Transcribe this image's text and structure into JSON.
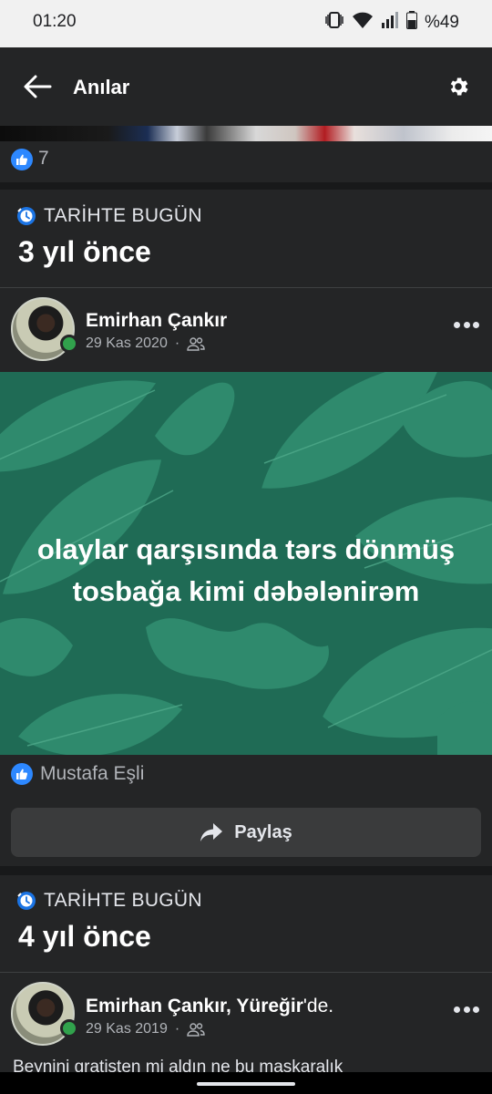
{
  "status_bar": {
    "time": "01:20",
    "battery": "%49"
  },
  "app_bar": {
    "title": "Anılar"
  },
  "previous_post": {
    "like_count": "7"
  },
  "memory_1": {
    "section_label": "TARİHTE BUGÜN",
    "years_ago": "3 yıl önce",
    "author": "Emirhan Çankır",
    "date": "29 Kas 2020",
    "dot": "·",
    "post_text_line1": "olaylar qarşısında tərs dönmüş",
    "post_text_line2": "tosbağa kimi dəbələnirəm",
    "reaction_name": "Mustafa Eşli",
    "share_label": "Paylaş"
  },
  "memory_2": {
    "section_label": "TARİHTE BUGÜN",
    "years_ago": "4 yıl önce",
    "author": "Emirhan Çankır, ",
    "place": "Yüreğir",
    "place_suffix": "'de.",
    "date": "29 Kas 2019",
    "dot": "·",
    "text_snippet": "Beynini gratisten mi aldın ne bu maskaralık"
  },
  "icons": [
    "vibrate-icon",
    "wifi-icon",
    "signal-icon",
    "battery-icon",
    "back-arrow-icon",
    "gear-icon",
    "like-icon",
    "clock-icon",
    "friends-icon",
    "more-icon",
    "share-arrow-icon"
  ],
  "colors": {
    "background": "#18191a",
    "surface": "#242526",
    "post_bg": "#1f6b55",
    "like_blue": "#2d88ff",
    "online_green": "#31a24c"
  }
}
